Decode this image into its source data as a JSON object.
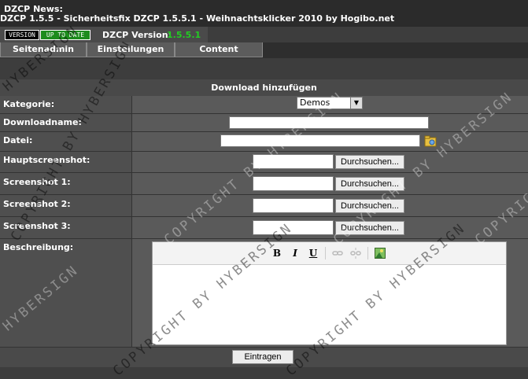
{
  "news": {
    "title": "DZCP News:",
    "text": "DZCP 1.5.5 - Sicherheitsfix DZCP 1.5.5.1 - Weihnachtsklicker 2010 by Hogibo.net"
  },
  "version": {
    "badge_left": "VERSION",
    "badge_right": "UP TO DATE",
    "label": "DZCP Version:",
    "number": "1.5.5.1"
  },
  "tabs": [
    "Seitenadmin",
    "Einstellungen",
    "Content"
  ],
  "form": {
    "header": "Download hinzufügen",
    "kategorie_label": "Kategorie:",
    "kategorie_value": "Demos",
    "downloadname_label": "Downloadname:",
    "datei_label": "Datei:",
    "hauptscreenshot_label": "Hauptscreenshot:",
    "screenshot1_label": "Screenshot 1:",
    "screenshot2_label": "Screenshot 2:",
    "screenshot3_label": "Screenshot 3:",
    "browse_label": "Durchsuchen...",
    "beschreibung_label": "Beschreibung:",
    "submit_label": "Eintragen"
  },
  "editor_toolbar": {
    "bold": "B",
    "italic": "I",
    "underline": "U",
    "link_icon": "link-icon",
    "unlink_icon": "unlink-icon",
    "image_icon": "image-icon"
  },
  "watermark": {
    "text1": "COPYRIGHT BY HYBERSIGN",
    "text2": "HYBERSIGN",
    "text3": "COPYRIG"
  },
  "colors": {
    "background": "#3d3d3d",
    "version_green": "#22cc22",
    "badge_green": "#1c8c1c"
  }
}
